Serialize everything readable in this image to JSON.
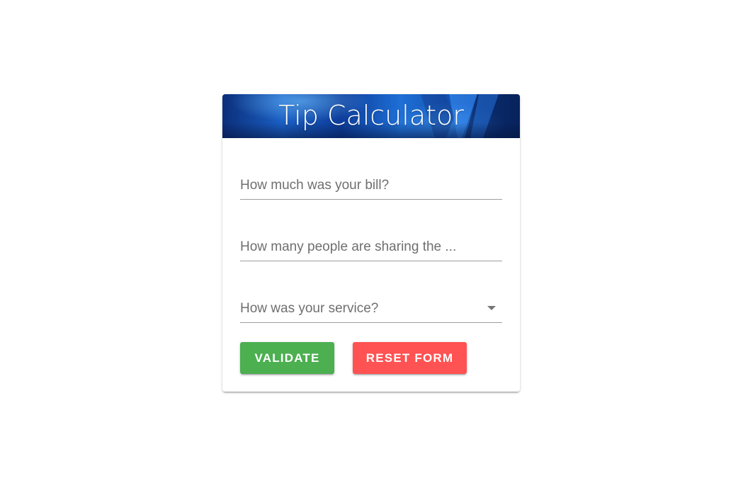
{
  "card": {
    "title": "Tip Calculator"
  },
  "form": {
    "bill_label": "How much was your bill?",
    "people_label": "How many people are sharing the ...",
    "service_label": "How was your service?"
  },
  "buttons": {
    "validate_label": "Validate",
    "reset_label": "Reset Form"
  },
  "colors": {
    "validate": "#4caf50",
    "reset": "#ff5252",
    "banner": "#1a5fc4"
  },
  "icons": {
    "service_dropdown": "caret-down-icon",
    "banner_logo": "vuetify-logo"
  }
}
